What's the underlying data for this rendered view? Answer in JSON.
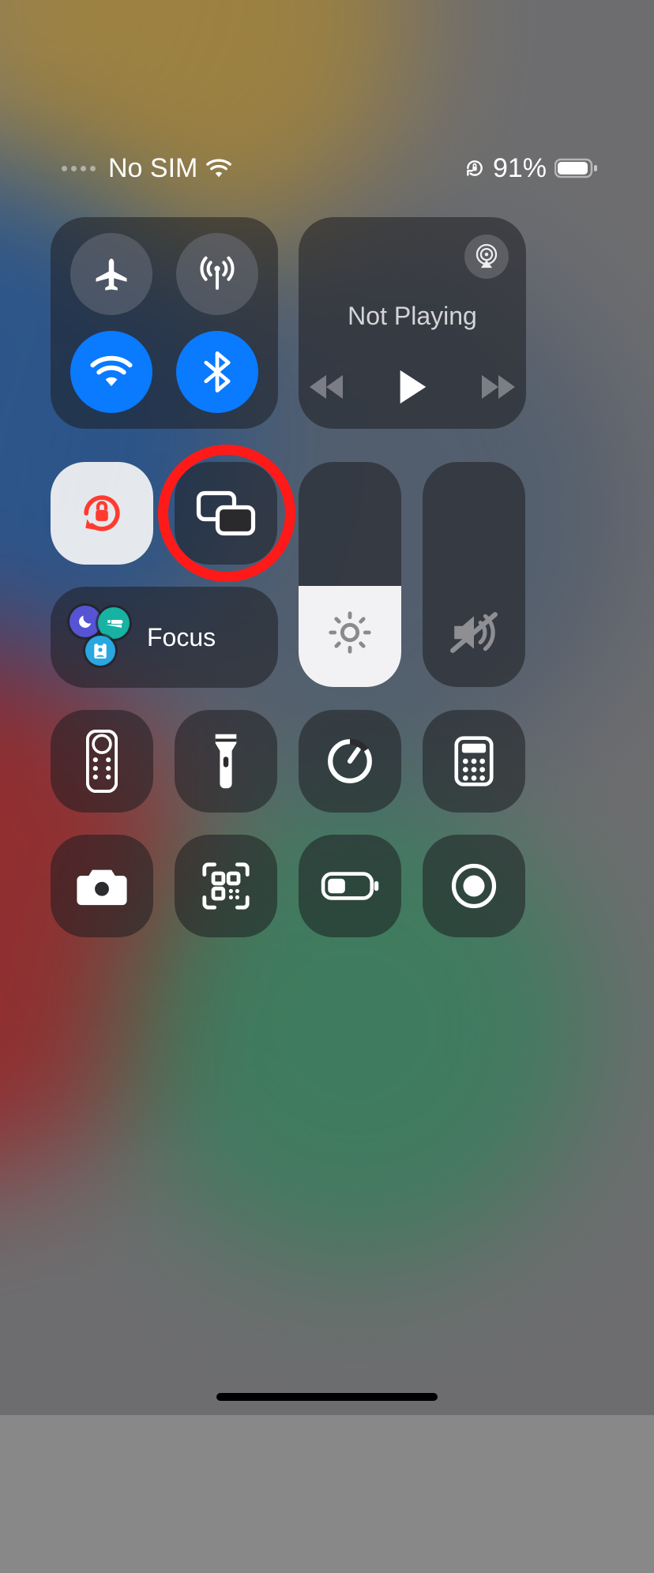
{
  "status": {
    "carrier": "No SIM",
    "battery_percent": "91%"
  },
  "media": {
    "now_playing": "Not Playing"
  },
  "focus": {
    "label": "Focus"
  },
  "brightness": {
    "level_percent": 45
  },
  "volume": {
    "level_percent": 0,
    "muted": true
  },
  "toggles": {
    "airplane_mode": false,
    "cellular": false,
    "wifi": true,
    "bluetooth": true,
    "orientation_lock": true
  },
  "annotation": {
    "highlighted_control": "screen-mirroring"
  },
  "icons": {
    "airplane": "airplane-icon",
    "cellular": "cellular-antenna-icon",
    "wifi": "wifi-icon",
    "bluetooth": "bluetooth-icon",
    "airplay": "airplay-icon",
    "rewind": "rewind-icon",
    "play": "play-icon",
    "forward": "forward-icon",
    "orientation_lock": "orientation-lock-icon",
    "screen_mirror": "screen-mirroring-icon",
    "brightness": "sun-icon",
    "volume_mute": "speaker-mute-icon",
    "moon": "moon-icon",
    "bed": "bed-icon",
    "badge": "id-badge-icon",
    "remote": "apple-tv-remote-icon",
    "flashlight": "flashlight-icon",
    "timer": "timer-icon",
    "calculator": "calculator-icon",
    "camera": "camera-icon",
    "qr": "qr-scanner-icon",
    "low_power": "low-power-mode-icon",
    "screen_record": "screen-record-icon"
  }
}
